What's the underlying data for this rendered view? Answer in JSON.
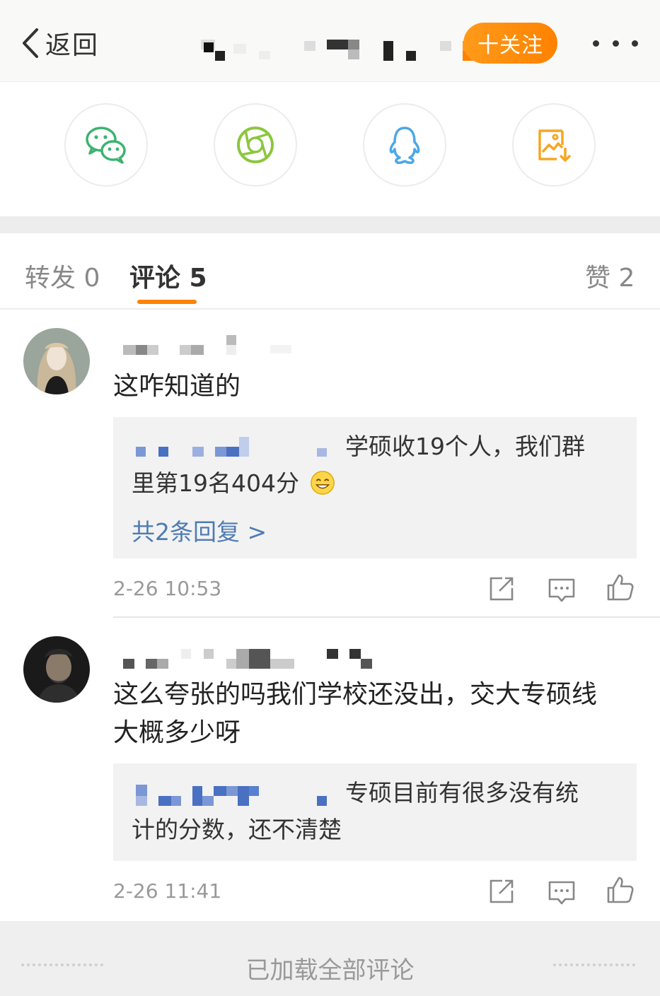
{
  "header": {
    "back_label": "返回",
    "follow_label": "十关注"
  },
  "share": [
    {
      "icon": "wechat-icon",
      "color": "#3cb371"
    },
    {
      "icon": "moments-icon",
      "color": "#8cc63f"
    },
    {
      "icon": "qq-icon",
      "color": "#4ba7e8"
    },
    {
      "icon": "save-image-icon",
      "color": "#f5a623"
    }
  ],
  "tabs": {
    "repost": "转发 0",
    "comments": "评论 5",
    "likes": "赞 2"
  },
  "comments": [
    {
      "text": "这咋知道的",
      "reply": {
        "line1": "学硕收19个人，我们群",
        "line2": "里第19名404分",
        "more": "共2条回复 >"
      },
      "time": "2-26 10:53"
    },
    {
      "text_line1": "这么夸张的吗我们学校还没出，交大专硕线",
      "text_line2": "大概多少呀",
      "reply": {
        "line1": "专硕目前有很多没有统",
        "line2": "计的分数，还不清楚"
      },
      "time": "2-26 11:41"
    }
  ],
  "footer": {
    "text": "已加载全部评论"
  },
  "colors": {
    "accent": "#ff8200",
    "link": "#4e7cb3"
  }
}
